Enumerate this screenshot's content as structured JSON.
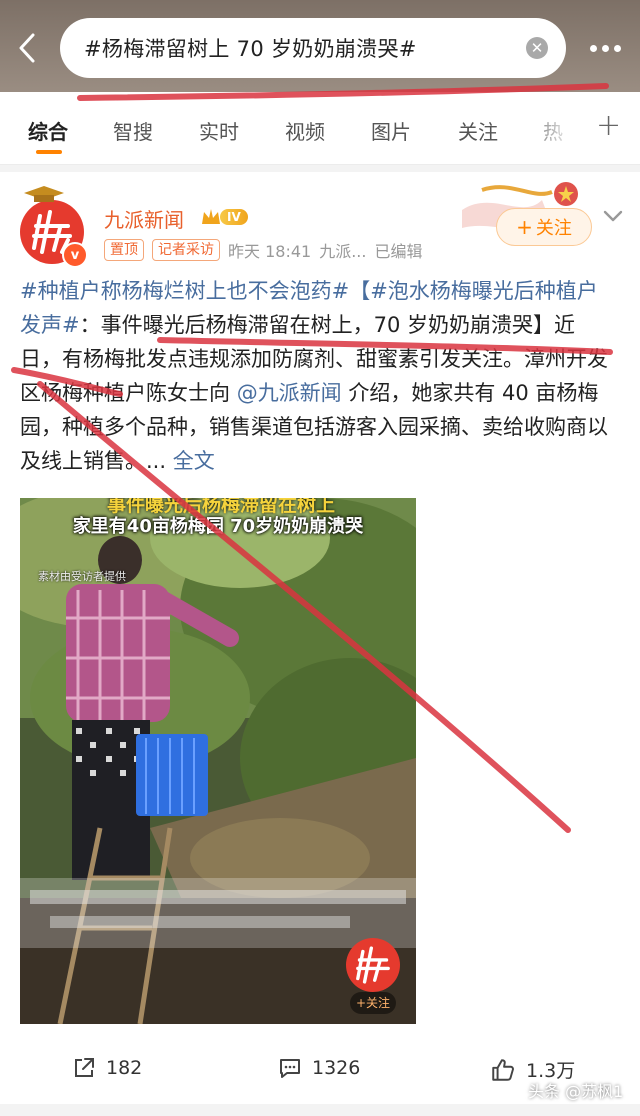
{
  "header": {
    "search_query": "#杨梅滞留树上 70 岁奶奶崩溃哭#",
    "back_icon": "back-arrow-icon",
    "clear_icon": "clear-icon",
    "more_icon": "more-icon"
  },
  "tabs": [
    {
      "label": "综合",
      "active": true
    },
    {
      "label": "智搜"
    },
    {
      "label": "实时"
    },
    {
      "label": "视频"
    },
    {
      "label": "图片"
    },
    {
      "label": "关注"
    },
    {
      "label": "热"
    }
  ],
  "tabs_add": "+",
  "post": {
    "author": "九派新闻",
    "level": "IV",
    "tag_pin": "置顶",
    "tag_reporter": "记者采访",
    "timestamp": "昨天 18:41",
    "source": "九派...",
    "edited": "已编辑",
    "follow_label": "关注",
    "follow_plus": "+",
    "text": {
      "tag1": "#种植户称杨梅烂树上也不会泡药#",
      "tag2": "【#泡水杨梅曝光后种植户发声#",
      "body1": "：事件曝光后杨梅滞留在树上，70 岁奶奶崩溃哭】近日，有杨梅批发点违规添加防腐剂、甜蜜素引发关注。漳州开发区杨梅种植户陈女士向 ",
      "mention": "@九派新闻",
      "body2": " 介绍，她家共有 40 亩杨梅园，种植多个品种，销售渠道包括游客入园采摘、卖给收购商以及线上销售。... ",
      "more": "全文"
    },
    "video": {
      "caption_top": "事件曝光后杨梅滞留在树上",
      "caption": "家里有40亩杨梅园 70岁奶奶崩溃哭",
      "source_note": "素材由受访者提供",
      "follow_label": "+关注"
    },
    "actions": {
      "share": "182",
      "comment": "1326",
      "like": "1.3万"
    }
  },
  "watermark": "头条 @苏枫1",
  "colors": {
    "accent": "#ff8200",
    "link": "#486d9e",
    "author": "#e8602c",
    "annotation": "#d9343f"
  }
}
